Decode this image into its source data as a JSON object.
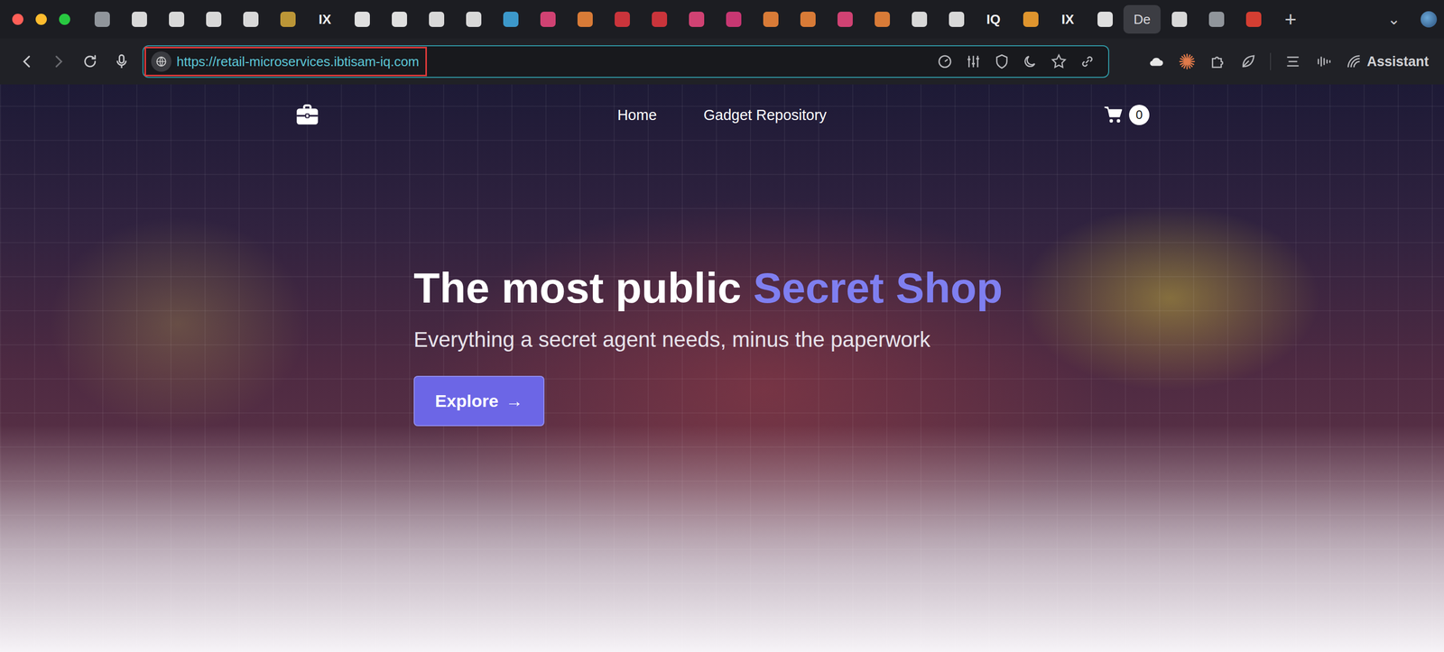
{
  "window": {
    "controls": [
      {
        "color": "#ff5f57"
      },
      {
        "color": "#febc2e"
      },
      {
        "color": "#28c840"
      }
    ]
  },
  "tabs": [
    {
      "kind": "favicon",
      "color": "#9aa0a6",
      "selected": false
    },
    {
      "kind": "favicon",
      "color": "#e8e8e8",
      "selected": false
    },
    {
      "kind": "favicon",
      "color": "#e8e8e8",
      "selected": false
    },
    {
      "kind": "favicon",
      "color": "#e8e8e8",
      "selected": false
    },
    {
      "kind": "favicon",
      "color": "#e8e8e8",
      "selected": false
    },
    {
      "kind": "favicon",
      "color": "#c9a13a",
      "selected": false
    },
    {
      "kind": "text",
      "label": "IX",
      "selected": false
    },
    {
      "kind": "favicon",
      "color": "#f0f0f0",
      "selected": false
    },
    {
      "kind": "favicon",
      "color": "#f0f0f0",
      "selected": false
    },
    {
      "kind": "favicon",
      "color": "#e8e8e8",
      "selected": false
    },
    {
      "kind": "favicon",
      "color": "#e8e8e8",
      "selected": false
    },
    {
      "kind": "favicon",
      "color": "#3fa3d9",
      "selected": false
    },
    {
      "kind": "favicon",
      "color": "#e0457b",
      "selected": false
    },
    {
      "kind": "favicon",
      "color": "#e8833a",
      "selected": false
    },
    {
      "kind": "favicon",
      "color": "#d9363e",
      "selected": false
    },
    {
      "kind": "favicon",
      "color": "#d9363e",
      "selected": false
    },
    {
      "kind": "favicon",
      "color": "#e0457b",
      "selected": false
    },
    {
      "kind": "favicon",
      "color": "#d63a7a",
      "selected": false
    },
    {
      "kind": "favicon",
      "color": "#e8833a",
      "selected": false
    },
    {
      "kind": "favicon",
      "color": "#e8833a",
      "selected": false
    },
    {
      "kind": "favicon",
      "color": "#e0457b",
      "selected": false
    },
    {
      "kind": "favicon",
      "color": "#e8833a",
      "selected": false
    },
    {
      "kind": "favicon",
      "color": "#e8e8e8",
      "selected": false
    },
    {
      "kind": "favicon",
      "color": "#e8e8e8",
      "selected": false
    },
    {
      "kind": "text",
      "label": "IQ",
      "selected": false
    },
    {
      "kind": "favicon",
      "color": "#f0a030",
      "selected": false
    },
    {
      "kind": "text",
      "label": "IX",
      "selected": false
    },
    {
      "kind": "favicon",
      "color": "#f0f0f0",
      "selected": false
    },
    {
      "kind": "text",
      "label": "De",
      "selected": true
    },
    {
      "kind": "favicon",
      "color": "#e8e8e8",
      "selected": false
    },
    {
      "kind": "favicon",
      "color": "#9aa0a6",
      "selected": false
    },
    {
      "kind": "favicon",
      "color": "#e44134",
      "selected": false
    }
  ],
  "new_tab": "+",
  "tab_menu": "⌄",
  "address_bar": {
    "url": "https://retail-microservices.ibtisam-iq.com",
    "highlighted": true
  },
  "toolbar": {
    "assistant": "Assistant"
  },
  "page": {
    "nav": {
      "links": [
        {
          "label": "Home"
        },
        {
          "label": "Gadget Repository"
        }
      ],
      "cart_count": "0"
    },
    "hero": {
      "title": "The most public",
      "title_accent": "Secret Shop",
      "subtitle": "Everything a secret agent needs, minus the paperwork",
      "button": "Explore",
      "button_icon": "→"
    }
  }
}
